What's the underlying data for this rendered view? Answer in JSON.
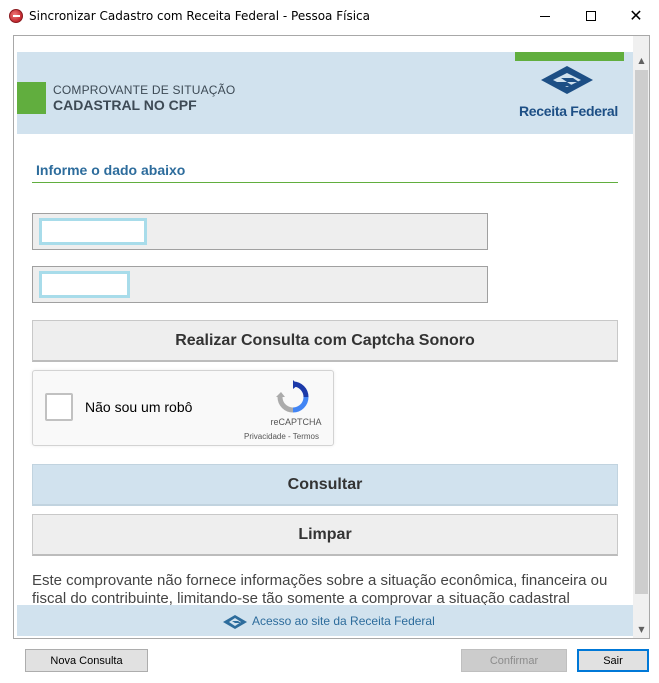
{
  "window": {
    "title": "Sincronizar Cadastro com Receita Federal - Pessoa Física",
    "minimize_glyph": "",
    "close_glyph": "✕"
  },
  "banner": {
    "line1": "COMPROVANTE DE SITUAÇÃO",
    "line2": "CADASTRAL NO CPF",
    "brand": "Receita Federal"
  },
  "form": {
    "section_title": "Informe o dado abaixo",
    "input1_value": "",
    "input2_value": "",
    "captcha_audio_button": "Realizar Consulta com Captcha Sonoro"
  },
  "recaptcha": {
    "label": "Não sou um robô",
    "brand": "reCAPTCHA",
    "terms": "Privacidade - Termos",
    "checked": false
  },
  "buttons": {
    "consultar": "Consultar",
    "limpar": "Limpar"
  },
  "disclaimer": "Este comprovante não fornece informações sobre a situação econômica, financeira ou fiscal do contribuinte, limitando-se tão somente a comprovar a situação cadastral",
  "footer": {
    "link": "Acesso ao site da Receita Federal"
  },
  "scrollbar": {
    "up_glyph": "▲",
    "down_glyph": "▼"
  },
  "bottom_bar": {
    "nova_consulta": "Nova Consulta",
    "confirmar": "Confirmar",
    "sair": "Sair"
  },
  "colors": {
    "banner_bg": "#d1e2ee",
    "accent_green": "#61ae3e",
    "brand_blue": "#1d4f85",
    "focus_blue": "#0078d7"
  },
  "icons": [
    "app-icon",
    "receita-federal-logo-icon",
    "recaptcha-logo-icon",
    "footer-receita-logo-icon",
    "scroll-up-icon",
    "scroll-down-icon"
  ]
}
